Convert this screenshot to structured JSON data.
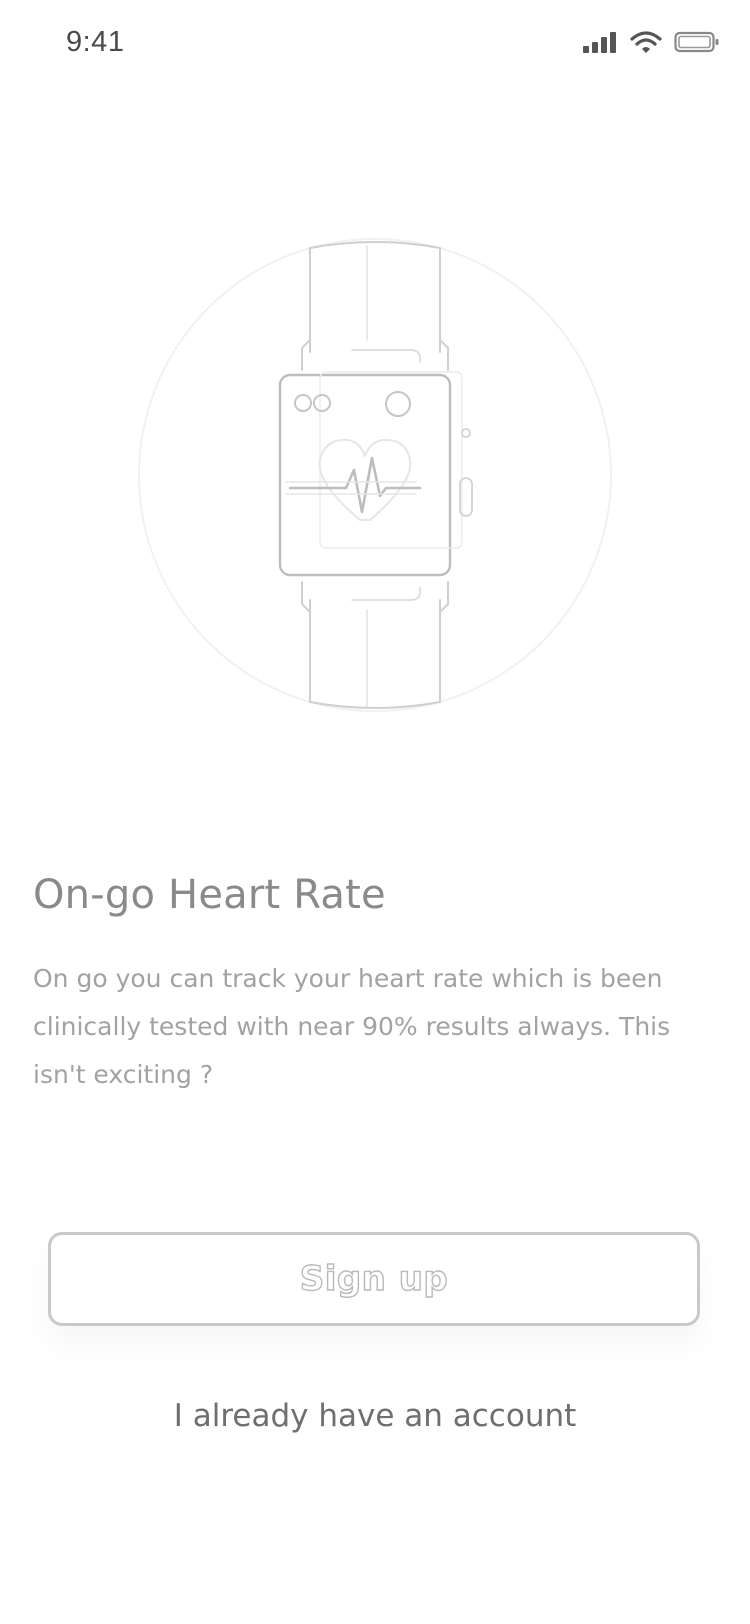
{
  "status_bar": {
    "time": "9:41",
    "icons": [
      "cellular-signal-icon",
      "wifi-icon",
      "battery-icon"
    ]
  },
  "onboarding": {
    "illustration": "smartwatch-heart-rate-icon",
    "title": "On-go Heart Rate",
    "description": "On go you can track your heart rate which is been clinically tested with near 90% results always. This isn't exciting ?"
  },
  "actions": {
    "signup_label": "Sign up",
    "login_label": "I already have an account"
  },
  "colors": {
    "text_primary": "#8a8a8a",
    "text_secondary": "#a2a2a2",
    "outline": "#c9c9c9",
    "background": "#ffffff"
  }
}
